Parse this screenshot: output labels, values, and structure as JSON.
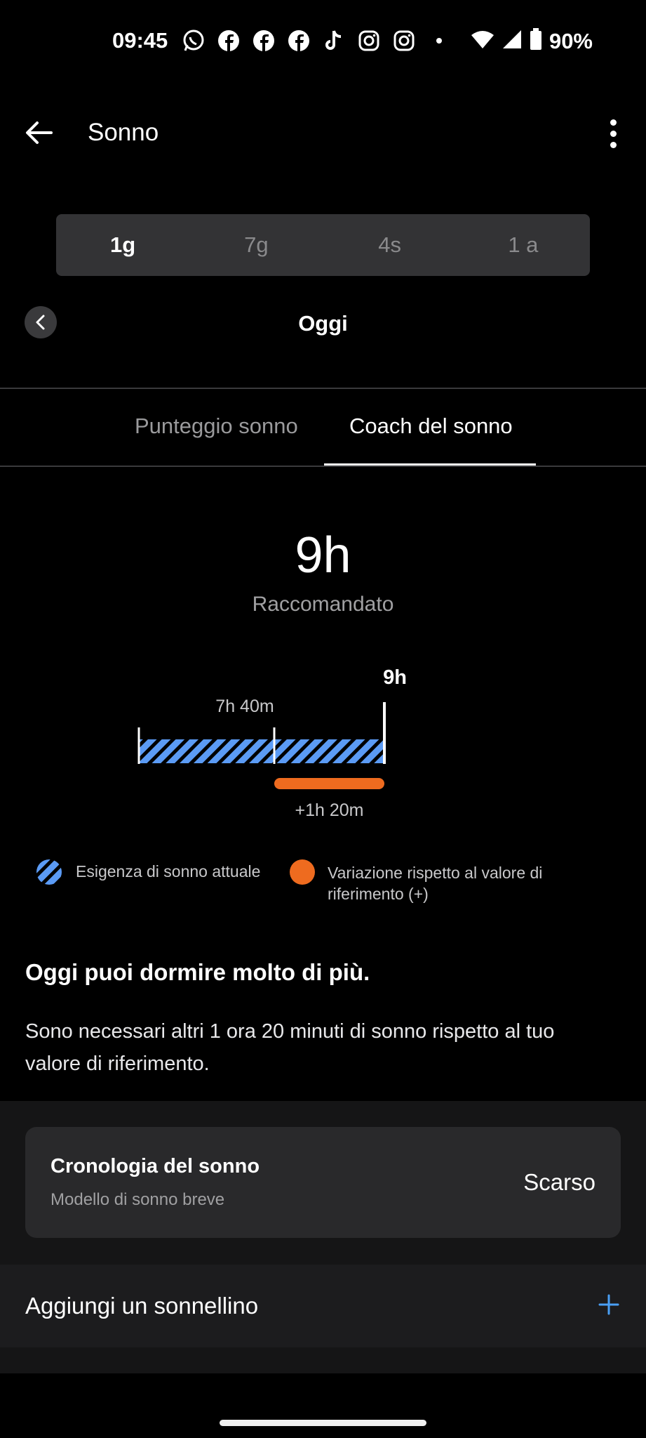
{
  "status_bar": {
    "time": "09:45",
    "notification_icons": [
      "whatsapp-icon",
      "facebook-icon",
      "facebook-icon",
      "facebook-icon",
      "tiktok-icon",
      "instagram-icon",
      "instagram-icon",
      "dot-icon"
    ],
    "battery": "90%"
  },
  "app_bar": {
    "title": "Sonno"
  },
  "period_selector": {
    "options": [
      "1g",
      "7g",
      "4s",
      "1 a"
    ],
    "selected": "1g"
  },
  "date_nav": {
    "label": "Oggi"
  },
  "tabs": [
    {
      "label": "Punteggio sonno",
      "active": false
    },
    {
      "label": "Coach del sonno",
      "active": true
    }
  ],
  "recommendation": {
    "value": "9h",
    "caption": "Raccomandato"
  },
  "chart_data": {
    "type": "bar",
    "baseline_label": "7h 40m",
    "target_label": "9h",
    "delta_label": "+1h 20m",
    "baseline_hours": 7.667,
    "target_hours": 9,
    "delta_hours": 1.333,
    "colors": {
      "hatch": "#5b9bf5",
      "delta": "#ee6b1f"
    }
  },
  "legend": {
    "current_need": "Esigenza di sonno attuale",
    "variation": "Variazione rispetto al valore di riferimento (+)"
  },
  "advice": {
    "headline": "Oggi puoi dormire molto di più.",
    "body": "Sono necessari altri 1 ora 20 minuti di sonno rispetto al tuo valore di riferimento."
  },
  "history_card": {
    "title": "Cronologia del sonno",
    "subtitle": "Modello di sonno breve",
    "value": "Scarso"
  },
  "nap_row": {
    "label": "Aggiungi un sonnellino"
  },
  "colors": {
    "accent": "#4a9ff5",
    "orange": "#ee6b1f"
  }
}
